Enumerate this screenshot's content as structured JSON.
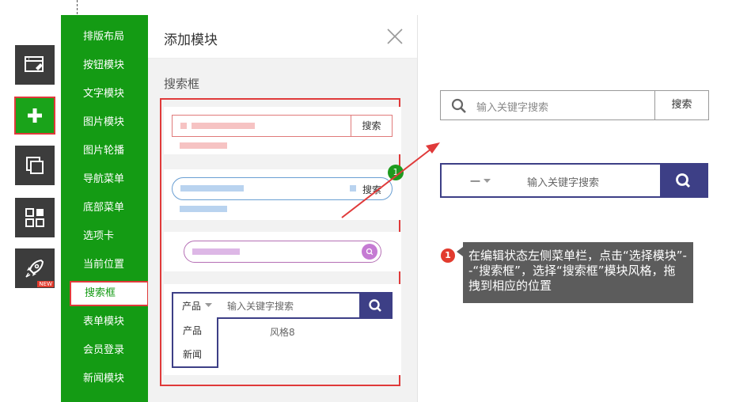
{
  "sidebar_menu": {
    "items": [
      "排版布局",
      "按钮模块",
      "文字模块",
      "图片模块",
      "图片轮播",
      "导航菜单",
      "底部菜单",
      "选项卡",
      "当前位置",
      "搜索框",
      "表单模块",
      "会员登录",
      "新闻模块"
    ],
    "active_index": 9
  },
  "toolbar": {
    "icons": [
      "layout-edit-icon",
      "add-icon",
      "pages-icon",
      "apps-icon",
      "rocket-icon"
    ],
    "new_badge": "NEW"
  },
  "panel": {
    "title": "添加模块",
    "section_title": "搜索框",
    "style1": {
      "button": "搜索"
    },
    "style2": {
      "badge": "1",
      "button": "搜索"
    },
    "style4": {
      "dropdown": "产品",
      "placeholder": "输入关键字搜索",
      "options": [
        "产品",
        "新闻"
      ],
      "style_label": "风格8"
    }
  },
  "preview": {
    "search1": {
      "placeholder": "输入关键字搜索",
      "button": "搜索"
    },
    "search2": {
      "dropdown": "一",
      "placeholder": "输入关键字搜索"
    }
  },
  "callout": {
    "badge": "1",
    "text": "在编辑状态左侧菜单栏，点击“选择模块”--“搜索框”，选择“搜索框”模块风格，拖拽到相应的位置"
  },
  "colors": {
    "green": "#149b14",
    "red": "#e03a3a",
    "navy": "#3d3f86",
    "dark": "#3c3c3c"
  }
}
